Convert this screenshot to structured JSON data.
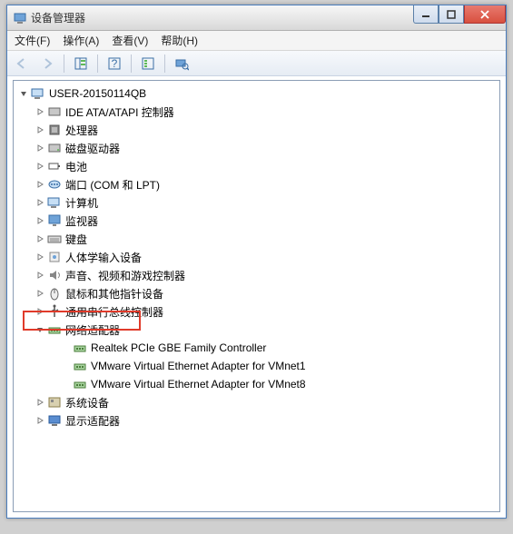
{
  "window": {
    "title": "设备管理器"
  },
  "menu": {
    "file": "文件(F)",
    "action": "操作(A)",
    "view": "查看(V)",
    "help": "帮助(H)"
  },
  "tree": {
    "root": "USER-20150114QB",
    "categories": [
      "IDE ATA/ATAPI 控制器",
      "处理器",
      "磁盘驱动器",
      "电池",
      "端口 (COM 和 LPT)",
      "计算机",
      "监视器",
      "键盘",
      "人体学输入设备",
      "声音、视频和游戏控制器",
      "鼠标和其他指针设备",
      "通用串行总线控制器",
      "网络适配器",
      "系统设备",
      "显示适配器"
    ],
    "network_children": [
      "Realtek PCIe GBE Family Controller",
      "VMware Virtual Ethernet Adapter for VMnet1",
      "VMware Virtual Ethernet Adapter for VMnet8"
    ]
  }
}
